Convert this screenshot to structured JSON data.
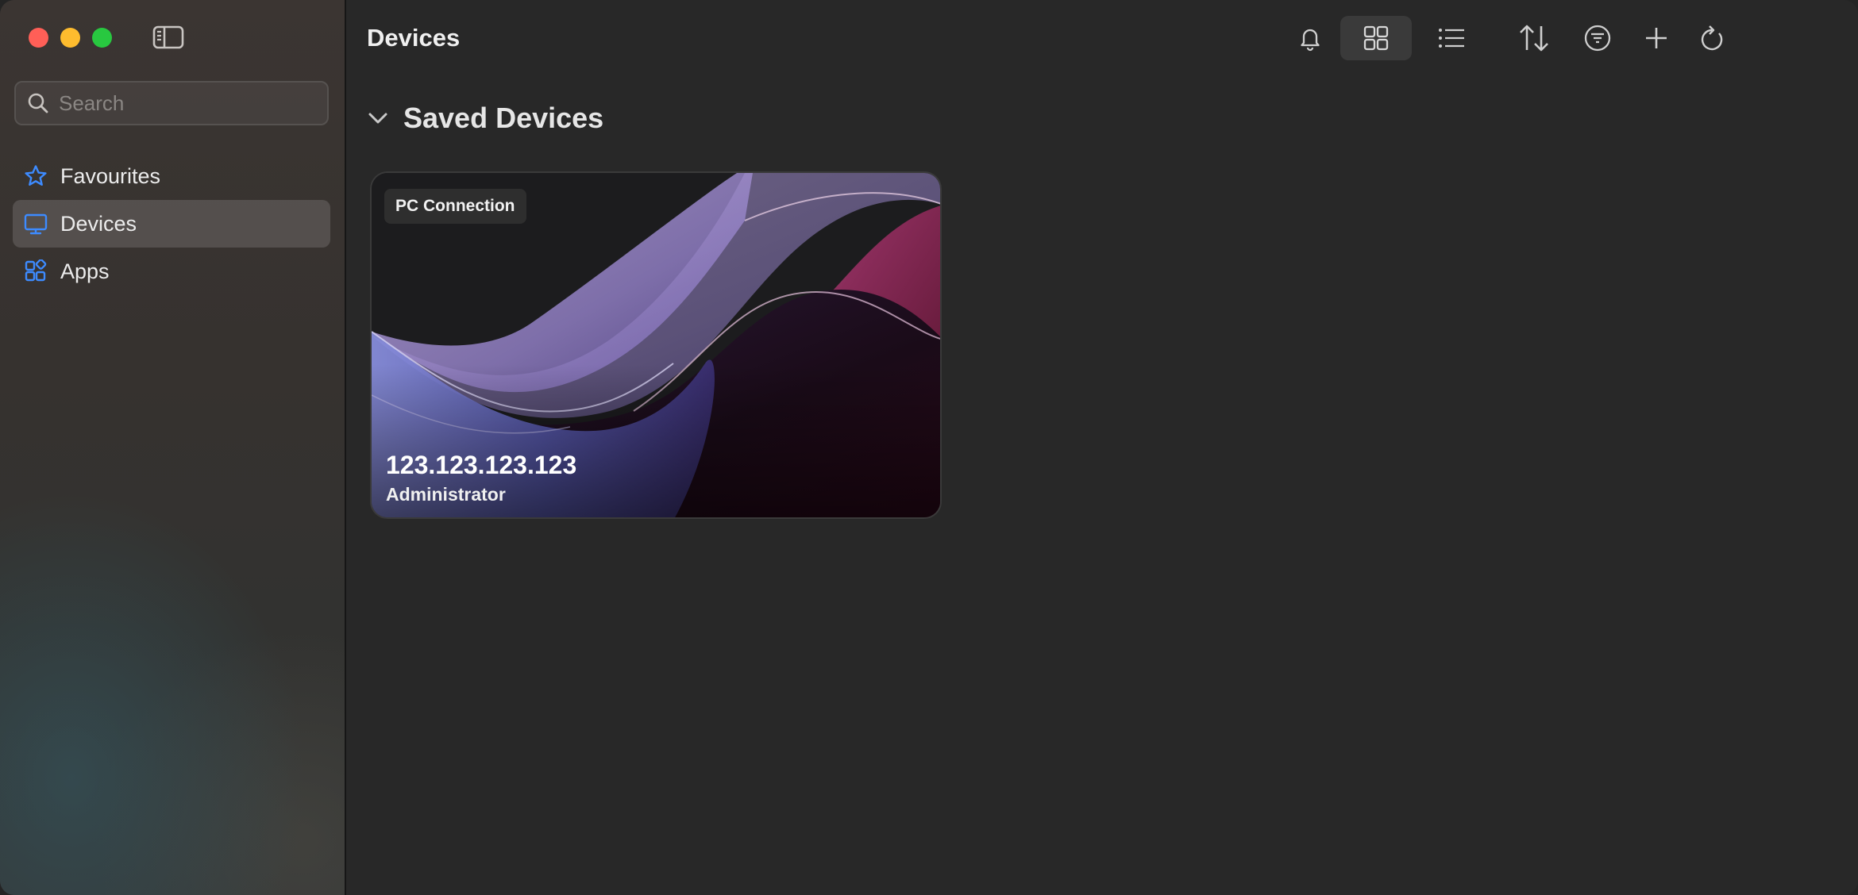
{
  "sidebar": {
    "search": {
      "placeholder": "Search",
      "value": ""
    },
    "items": [
      {
        "label": "Favourites",
        "icon": "star-icon",
        "active": false
      },
      {
        "label": "Devices",
        "icon": "monitor-icon",
        "active": true
      },
      {
        "label": "Apps",
        "icon": "apps-icon",
        "active": false
      }
    ]
  },
  "header": {
    "title": "Devices",
    "toolbar": [
      "bell-icon",
      "grid-view-icon",
      "list-view-icon",
      "sort-icon",
      "filter-icon",
      "plus-icon",
      "refresh-icon"
    ]
  },
  "section": {
    "title": "Saved Devices"
  },
  "devices": [
    {
      "badge": "PC Connection",
      "address": "123.123.123.123",
      "user": "Administrator"
    }
  ],
  "colors": {
    "accent": "#3d8bff",
    "close": "#ff5f57",
    "minimize": "#febc2e",
    "maximize": "#28c840"
  }
}
